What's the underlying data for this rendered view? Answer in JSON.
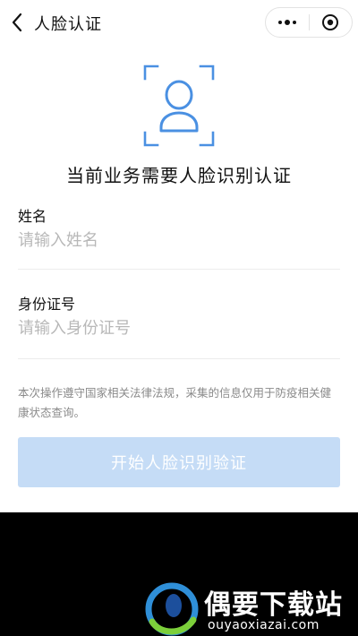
{
  "header": {
    "title": "人脸认证",
    "back_icon": "chevron-left-icon",
    "more_icon": "more-dots-icon",
    "close_icon": "target-circle-icon"
  },
  "face": {
    "icon": "face-scan-icon",
    "title": "当前业务需要人脸识别认证"
  },
  "form": {
    "name": {
      "label": "姓名",
      "placeholder": "请输入姓名",
      "value": ""
    },
    "id_number": {
      "label": "身份证号",
      "placeholder": "请输入身份证号",
      "value": ""
    }
  },
  "notice": "本次操作遵守国家相关法律法规，采集的信息仅用于防疫相关健康状态查询。",
  "start_button": {
    "label": "开始人脸识别验证",
    "enabled": false
  },
  "watermark": {
    "title": "偶要下载站",
    "url": "ouyaoxiazai.com"
  },
  "colors": {
    "accent": "#4a90e2",
    "button_disabled_bg": "#c5dcf6",
    "text": "#111111",
    "muted": "#8a8a8a"
  }
}
